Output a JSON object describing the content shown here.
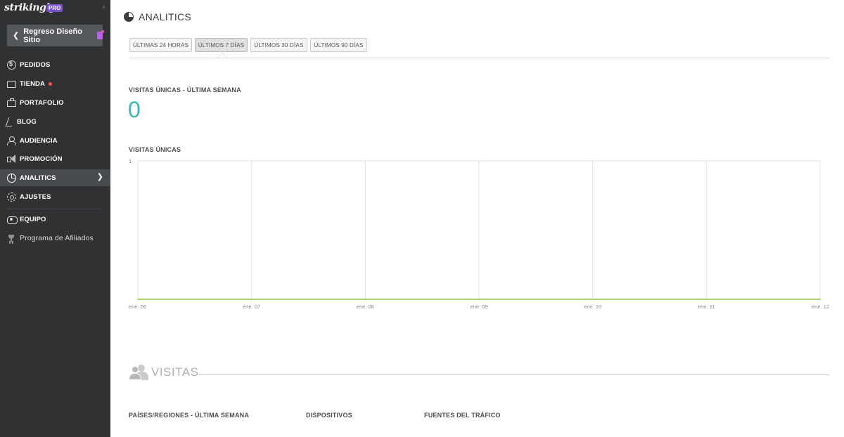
{
  "sidebar": {
    "logo": "strikingly",
    "badge": "PRO",
    "collapse_icon": "chevron-left-icon",
    "back_button": "Regreso Diseño Sitio",
    "items": [
      {
        "label": "PEDIDOS",
        "icon": "dollar-circle-icon"
      },
      {
        "label": "TIENDA",
        "icon": "store-icon",
        "notification_dot": true
      },
      {
        "label": "PORTAFOLIO",
        "icon": "portfolio-icon"
      },
      {
        "label": "BLOG",
        "icon": "pen-icon"
      },
      {
        "label": "AUDIENCIA",
        "icon": "user-icon"
      },
      {
        "label": "PROMOCIÓN",
        "icon": "megaphone-icon"
      },
      {
        "label": "ANALITICS",
        "icon": "pie-chart-icon",
        "active": true
      },
      {
        "label": "AJUSTES",
        "icon": "gear-icon"
      }
    ],
    "secondary": [
      {
        "label": "EQUIPO",
        "icon": "team-icon"
      },
      {
        "label": "Programa de Afiliados",
        "icon": "trophy-icon"
      }
    ]
  },
  "main": {
    "title": "ANALITICS",
    "tabs": [
      {
        "label": "ÚLTIMAS 24 HORAS"
      },
      {
        "label": "ÚLTIMOS 7 DÍAS",
        "active": true
      },
      {
        "label": "ÚLTIMOS 30 DÍAS"
      },
      {
        "label": "ÚLTIMOS 90 DÍAS"
      }
    ],
    "unique_visits_label": "VISITAS ÚNICAS - ÚLTIMA SEMANA",
    "unique_visits_value": "0",
    "chart_label": "VISITAS ÚNICAS",
    "visitas_title": "VISITAS",
    "bottom_sections": [
      "PAÍSES/REGIONES - ÚLTIMA SEMANA",
      "DISPOSITIVOS",
      "FUENTES DEL TRÁFICO"
    ]
  },
  "colors": {
    "sidebar_bg": "#2f3133",
    "accent_teal": "#3cb5b5",
    "line_green": "#8cc63f",
    "notification": "#f2564b",
    "pro_badge": "#7a4fd0"
  },
  "chart_data": {
    "type": "line",
    "title": "VISITAS ÚNICAS",
    "x": [
      "ene. 06",
      "ene. 07",
      "ene. 08",
      "ene. 09",
      "ene. 10",
      "ene. 11",
      "ene. 12"
    ],
    "series": [
      {
        "values": [
          0,
          0,
          0,
          0,
          0,
          0,
          0
        ]
      }
    ],
    "ylim": [
      0,
      1
    ],
    "y_ticks": [
      "1"
    ],
    "grid": "vertical"
  }
}
